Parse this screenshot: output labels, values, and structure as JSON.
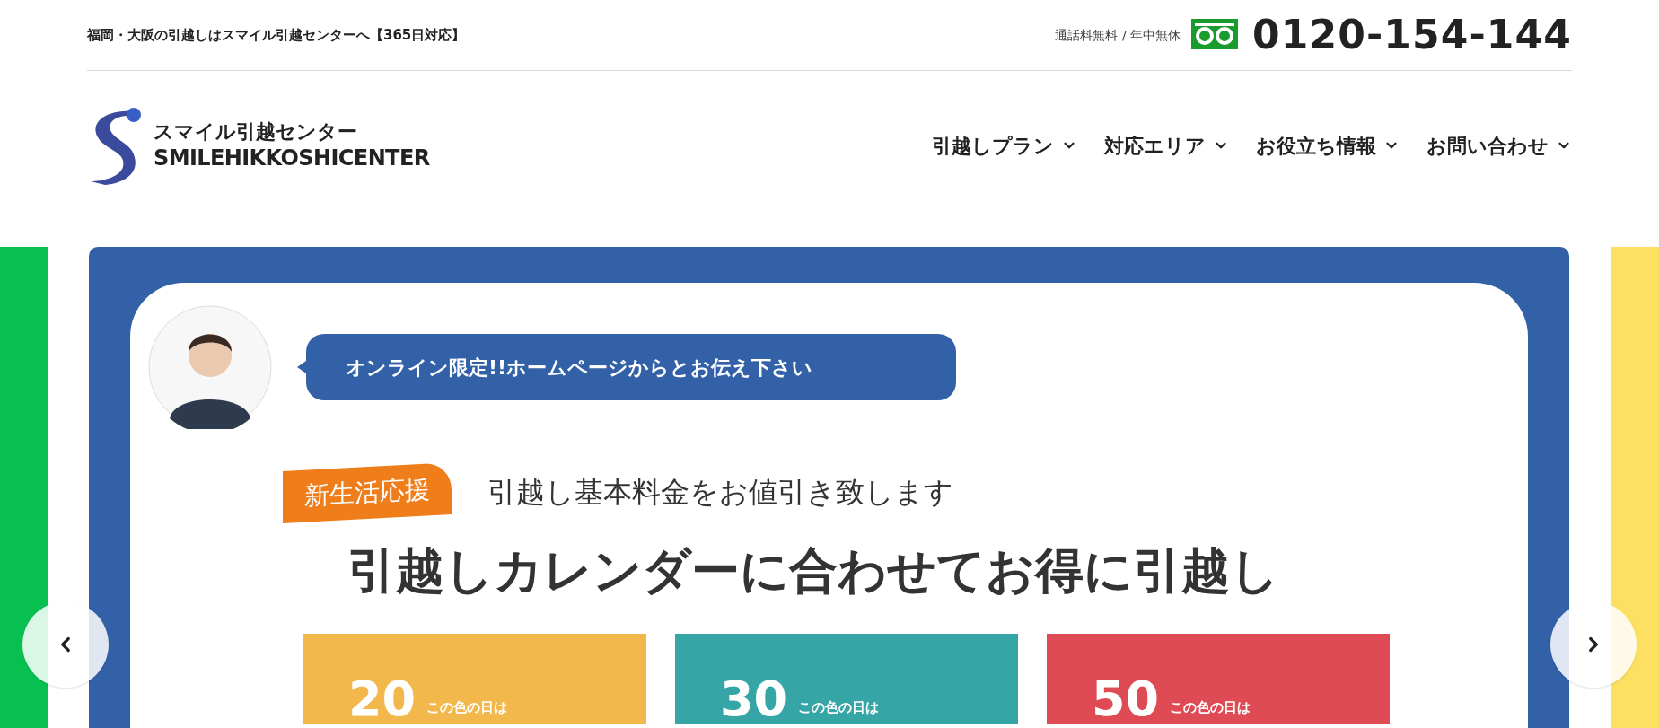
{
  "top_bar": {
    "tagline": "福岡・大阪の引越しはスマイル引越センターへ【365日対応】",
    "phone_note": "通話料無料 / 年中無休",
    "phone": "0120-154-144"
  },
  "logo": {
    "name_ja": "スマイル引越センター",
    "name_en": "SMILEHIKKOSHICENTER"
  },
  "nav": [
    {
      "label": "引越しプラン"
    },
    {
      "label": "対応エリア"
    },
    {
      "label": "お役立ち情報"
    },
    {
      "label": "お問い合わせ"
    }
  ],
  "banner": {
    "bubble": "オンライン限定!!ホームページからとお伝え下さい",
    "flag": "新生活応援",
    "subtitle": "引越し基本料金をお値引き致します",
    "heading": "引越しカレンダーに合わせてお得に引越し",
    "cards": [
      {
        "number": "20",
        "note": "この色の日は",
        "color": "#f2b84b"
      },
      {
        "number": "30",
        "note": "この色の日は",
        "color": "#35a6a5"
      },
      {
        "number": "50",
        "note": "この色の日は",
        "color": "#df4b55"
      }
    ]
  }
}
